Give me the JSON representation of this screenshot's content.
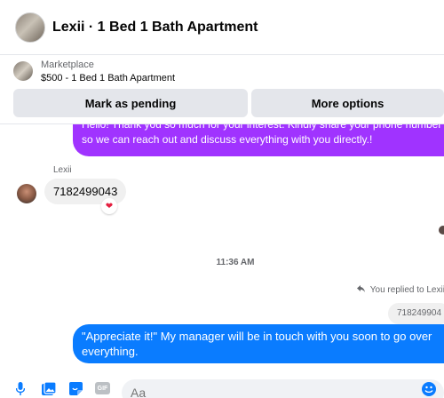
{
  "header": {
    "title": "Lexii · 1 Bed 1 Bath Apartment"
  },
  "marketplace": {
    "label": "Marketplace",
    "listing": "$500 - 1 Bed 1 Bath Apartment",
    "buttons": {
      "pending": "Mark as pending",
      "more": "More options"
    }
  },
  "messages": {
    "outgoing_top": "Hello! Thank you so much for your interest. Kindly share your phone number so we can reach out and discuss everything with you directly.!",
    "sender_name": "Lexii",
    "incoming_phone": "7182499043",
    "reaction": "❤",
    "timestamp": "11:36 AM",
    "replied_label": "You replied to Lexii",
    "quoted_text": "718249904",
    "outgoing_reply": "\"Appreciate it!\" My manager will be in touch with you soon to go over everything."
  },
  "composer": {
    "placeholder": "Aa",
    "gif_label": "GIF"
  },
  "colors": {
    "purple_bubble": "#a033ff",
    "blue_bubble": "#0a7cff",
    "incoming_bubble": "#f0f0f0",
    "icon_blue": "#0a7cff"
  },
  "icons": {
    "header_avatar": "listing-photo-avatar",
    "reply": "reply-arrow-icon",
    "mic": "microphone-icon",
    "photo": "photo-gallery-icon",
    "sticker": "sticker-icon",
    "gif": "gif-icon",
    "emoji": "emoji-icon"
  }
}
